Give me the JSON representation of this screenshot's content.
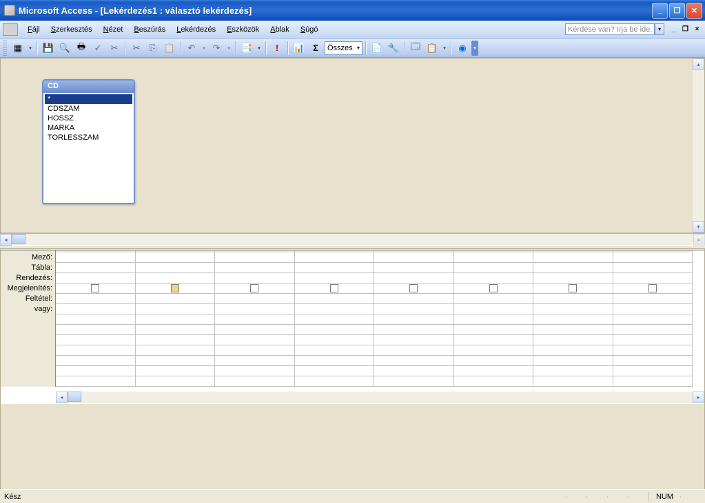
{
  "title": "Microsoft Access - [Lekérdezés1 : választó lekérdezés]",
  "menu": {
    "items": [
      {
        "label": "Fájl",
        "u": 0
      },
      {
        "label": "Szerkesztés",
        "u": 0
      },
      {
        "label": "Nézet",
        "u": 0
      },
      {
        "label": "Beszúrás",
        "u": 0
      },
      {
        "label": "Lekérdezés",
        "u": 0
      },
      {
        "label": "Eszközök",
        "u": 0
      },
      {
        "label": "Ablak",
        "u": 0
      },
      {
        "label": "Súgó",
        "u": 0
      }
    ],
    "help_placeholder": "Kérdése van? Írja be ide."
  },
  "toolbar": {
    "combo_value": "Összes"
  },
  "table_window": {
    "title": "CD",
    "fields": [
      "*",
      "CDSZAM",
      "HOSSZ",
      "MARKA",
      "TORLESSZAM"
    ]
  },
  "grid": {
    "row_labels": [
      "Mező:",
      "Tábla:",
      "Rendezés:",
      "Megjelenítés:",
      "Feltétel:",
      "vagy:"
    ],
    "columns": 8
  },
  "status": {
    "left": "Kész",
    "num": "NUM"
  }
}
